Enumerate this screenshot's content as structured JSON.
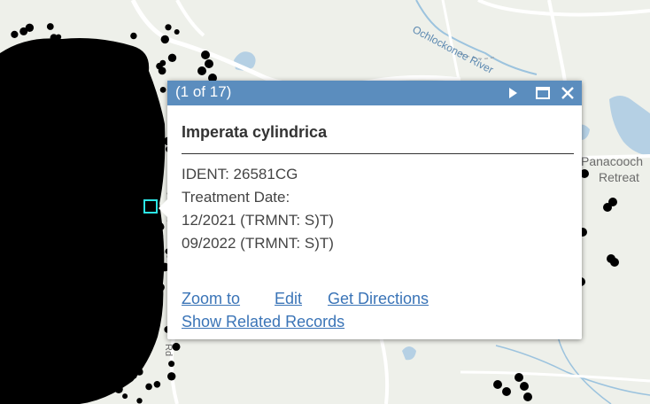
{
  "popup": {
    "counter": "(1 of 17)",
    "title": "Imperata cylindrica",
    "attributes": [
      "IDENT: 26581CG",
      "Treatment Date:",
      "12/2021 (TRMNT: S)T)",
      "09/2022 (TRMNT: S)T)"
    ],
    "actions": {
      "zoom": "Zoom to",
      "edit": "Edit",
      "directions": "Get Directions",
      "related": "Show Related Records"
    },
    "header_color": "#5b8dbe",
    "link_color": "#3a74b7"
  },
  "map": {
    "labels": {
      "river": "Ochlockonee River",
      "place_line1": "Panacooch",
      "place_line2": "Retreat",
      "road": "Rd"
    },
    "highlight_color": "#2ce6e6",
    "feature_color": "#000000",
    "icons": [
      "next-arrow-icon",
      "maximize-icon",
      "close-icon"
    ]
  }
}
